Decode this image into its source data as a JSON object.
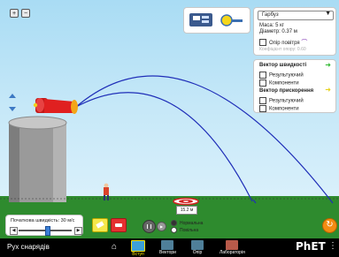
{
  "app": {
    "title": "Рух снарядів",
    "brand": "PhET"
  },
  "object_selector": {
    "selected": "Гарбуз",
    "mass": "Маса: 5 кг",
    "diameter": "Діаметр: 0.37 м"
  },
  "air_resistance": {
    "label": "Опір повітря",
    "drag_coefficient": "Коефіцієнт опору: 0.60",
    "checked": false
  },
  "vectors_panel": {
    "velocity_title": "Вектор швидкості",
    "velocity_items": [
      "Результуючий",
      "Компоненти"
    ],
    "acceleration_title": "Вектор прискорення",
    "acceleration_items": [
      "Результуючий",
      "Компоненти"
    ]
  },
  "launch_controls": {
    "speed_label": "Початкова швидкість: 30 м/с",
    "speed_value": 30
  },
  "target": {
    "distance": "15.2 м"
  },
  "playback": {
    "options": [
      "Нормальна",
      "Повільна"
    ],
    "selected": "Нормальна"
  },
  "nav": {
    "tabs": [
      {
        "label": "Вступ",
        "active": true
      },
      {
        "label": "Вектори",
        "active": false
      },
      {
        "label": "Опір",
        "active": false
      },
      {
        "label": "Лабораторія",
        "active": false
      }
    ]
  },
  "colors": {
    "sky": "#b7e2f6",
    "ground": "#2e8b2e",
    "trajectory": "#1f2eb8",
    "cannon": "#e02020",
    "vector_green": "#2fb82f",
    "vector_yellow": "#e6d21b"
  }
}
